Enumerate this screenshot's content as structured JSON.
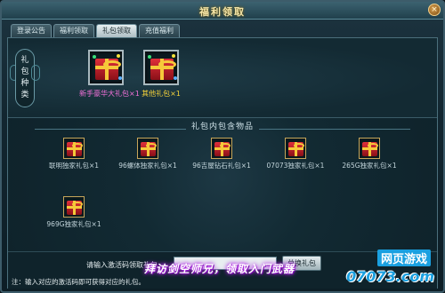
{
  "window": {
    "title": "福利领取",
    "close_label": "×"
  },
  "tabs": [
    {
      "label": "登录公告",
      "active": false
    },
    {
      "label": "福利领取",
      "active": false
    },
    {
      "label": "礼包领取",
      "active": true
    },
    {
      "label": "充值福利",
      "active": false
    }
  ],
  "pack_types": {
    "label_chars": [
      "礼",
      "包",
      "种",
      "类"
    ],
    "items": [
      {
        "name": "新手豪华大礼包×1",
        "color": "#f170d8",
        "icon": "gift-box-icon"
      },
      {
        "name": "其他礼包×1",
        "color": "#f5d33a",
        "icon": "gift-box-icon"
      }
    ]
  },
  "contents": {
    "title": "礼包内包含物品",
    "items": [
      {
        "name": "联明独家礼包×1",
        "icon": "gift-box-icon"
      },
      {
        "name": "96螺体独家礼包×1",
        "icon": "gift-box-icon"
      },
      {
        "name": "96吉屋钻石礼包×1",
        "icon": "gift-box-icon"
      },
      {
        "name": "07073独家礼包×1",
        "icon": "gift-box-icon"
      },
      {
        "name": "265G独家礼包×1",
        "icon": "gift-box-icon"
      },
      {
        "name": "969G独家礼包×1",
        "icon": "gift-box-icon"
      }
    ]
  },
  "redeem": {
    "label": "请输入激活码领取礼包:",
    "input_value": "",
    "input_placeholder": "",
    "button_label": "兑换礼包",
    "note": "注：输入对应的激活码即可获得对应的礼包。"
  },
  "promo_text": "拜访剑空师兄，领取入门武器",
  "watermark": {
    "line1": "网页游戏",
    "line2": "07073.com"
  }
}
